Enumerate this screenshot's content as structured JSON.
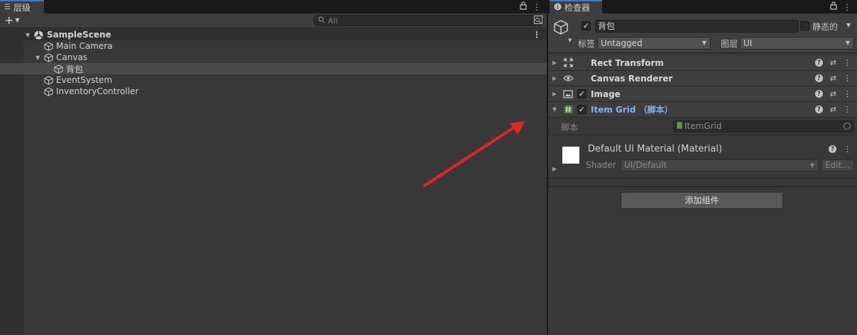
{
  "hierarchy": {
    "tab_label": "层级",
    "search_placeholder": "All",
    "add_label": "+",
    "items": [
      {
        "label": "SampleScene"
      },
      {
        "label": "Main Camera"
      },
      {
        "label": "Canvas"
      },
      {
        "label": "背包"
      },
      {
        "label": "EventSystem"
      },
      {
        "label": "InventoryController"
      }
    ]
  },
  "inspector": {
    "tab_label": "检查器",
    "object_name": "背包",
    "active_checked": true,
    "static_label": "静态的",
    "static_checked": false,
    "tag_label": "标签",
    "tag_value": "Untagged",
    "layer_label": "图层",
    "layer_value": "UI",
    "components": [
      {
        "name": "Rect Transform",
        "icon": "rect-transform-icon",
        "has_checkbox": false,
        "expanded": false
      },
      {
        "name": "Canvas Renderer",
        "icon": "eye-icon",
        "has_checkbox": false,
        "expanded": false
      },
      {
        "name": "Image",
        "icon": "image-icon",
        "has_checkbox": true,
        "expanded": false
      },
      {
        "name": "Item Grid （脚本）",
        "icon": "script-icon",
        "has_checkbox": true,
        "expanded": true
      }
    ],
    "script_field_label": "脚本",
    "script_field_value": "ItemGrid",
    "material": {
      "title": "Default UI Material (Material)",
      "shader_label": "Shader",
      "shader_value": "UI/Default",
      "edit_label": "Edit..."
    },
    "add_component_label": "添加组件"
  },
  "colors": {
    "panel_bg": "#383838",
    "accent_tab": "#3a79bb",
    "script_name": "#7fb3f0",
    "annotation_arrow": "#e0262b"
  }
}
